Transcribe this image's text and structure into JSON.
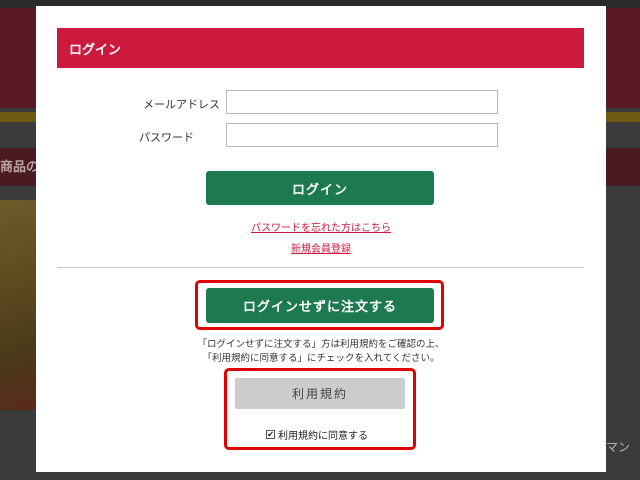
{
  "background": {
    "section_heading": "商品の",
    "right_fragment": "マン"
  },
  "modal": {
    "title": "ログイン",
    "email_label": "メールアドレス",
    "email_value": "",
    "password_label": "パスワード",
    "password_value": "",
    "login_button": "ログイン",
    "forgot_password_link": "パスワードを忘れた方はこちら",
    "register_link": "新規会員登録",
    "guest_order_button": "ログインせずに注文する",
    "notice_line1": "「ログインせずに注文する」方は利用規約をご確認の上、",
    "notice_line2": "「利用規約に同意する」にチェックを入れてください。",
    "terms_button": "利用規約",
    "agree_label": "利用規約に同意する",
    "agree_checked": true
  },
  "colors": {
    "header_red": "#cc1a3f",
    "button_green": "#1d7a4e",
    "highlight_red": "#e00000",
    "terms_gray": "#cccccc"
  },
  "icons": {
    "agree_checkbox": "checkmark-icon"
  }
}
